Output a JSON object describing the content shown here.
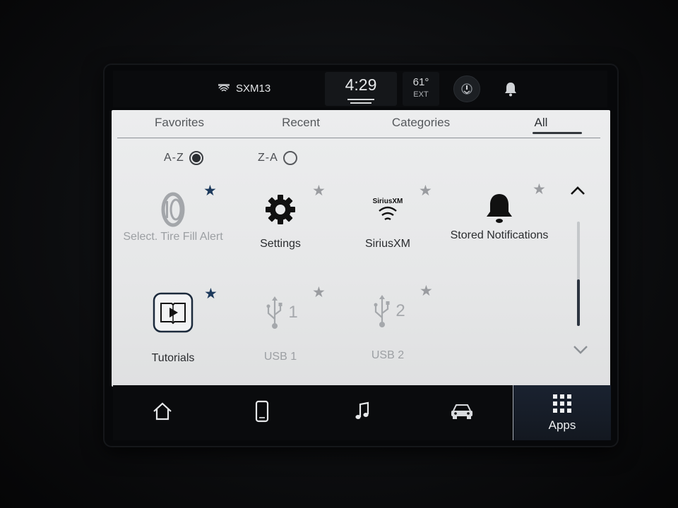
{
  "status_bar": {
    "radio_source": "SXM13",
    "time": "4:29",
    "temperature": "61°",
    "temperature_label": "EXT"
  },
  "tabs": [
    {
      "label": "Favorites",
      "active": false
    },
    {
      "label": "Recent",
      "active": false
    },
    {
      "label": "Categories",
      "active": false
    },
    {
      "label": "All",
      "active": true
    }
  ],
  "sort": {
    "options": [
      {
        "label": "A-Z",
        "selected": true
      },
      {
        "label": "Z-A",
        "selected": false
      }
    ]
  },
  "apps": [
    {
      "label": "Select. Tire Fill Alert",
      "icon": "tire-icon",
      "favorite": true,
      "enabled": false
    },
    {
      "label": "Settings",
      "icon": "gear-icon",
      "favorite": false,
      "enabled": true
    },
    {
      "label": "SiriusXM",
      "icon": "siriusxm-icon",
      "logo_text": "SiriusXM",
      "favorite": false,
      "enabled": true
    },
    {
      "label": "Stored Notifications",
      "icon": "bell-icon",
      "favorite": false,
      "enabled": true
    },
    {
      "label": "Tutorials",
      "icon": "tutorials-icon",
      "favorite": true,
      "enabled": true
    },
    {
      "label": "USB 1",
      "icon": "usb-icon",
      "badge": "1",
      "favorite": false,
      "enabled": false
    },
    {
      "label": "USB 2",
      "icon": "usb-icon",
      "badge": "2",
      "favorite": false,
      "enabled": false
    }
  ],
  "bottom_nav": [
    {
      "icon": "home-icon"
    },
    {
      "icon": "phone-icon"
    },
    {
      "icon": "music-note-icon"
    },
    {
      "icon": "vehicle-icon"
    },
    {
      "icon": "grid-icon",
      "label": "Apps",
      "active": true
    }
  ],
  "colors": {
    "favorite_star": "#1d3a5c",
    "unfavorite_star": "#9a9ca0",
    "panel_bg": "#e8e9ea",
    "apps_active_bg": "#1a2230"
  }
}
